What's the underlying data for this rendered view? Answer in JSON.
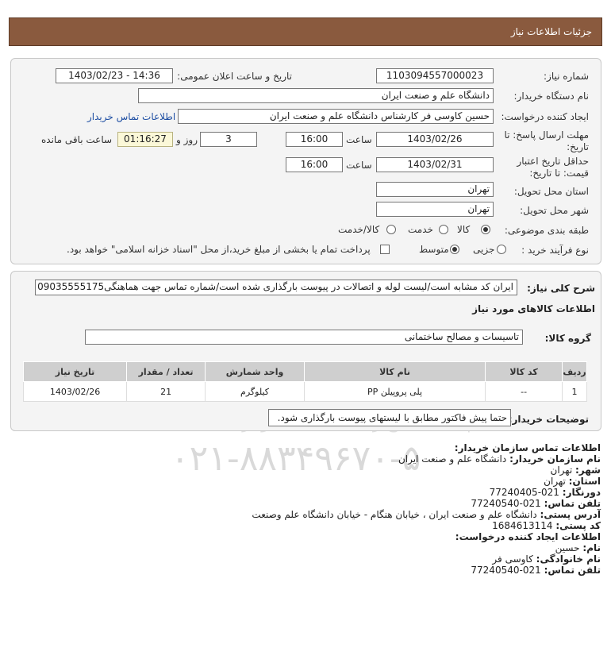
{
  "header": {
    "title": "جزئیات اطلاعات نیاز"
  },
  "form": {
    "need_number_label": "شماره نیاز:",
    "need_number": "1103094557000023",
    "announce_label": "تاریخ و ساعت اعلان عمومی:",
    "announce_value": "1403/02/23 - 14:36",
    "buyer_org_label": "نام دستگاه خریدار:",
    "buyer_org": "دانشگاه علم و صنعت ایران",
    "requester_label": "ایجاد کننده درخواست:",
    "requester": "حسین کاوسی فر کارشناس دانشگاه علم و صنعت ایران",
    "buyer_contact_link": "اطلاعات تماس خریدار",
    "deadline_label_1": "مهلت ارسال پاسخ: تا",
    "deadline_label_2": "تاریخ:",
    "deadline_date": "1403/02/26",
    "time_label": "ساعت",
    "deadline_time": "16:00",
    "days_value": "3",
    "days_label": "روز و",
    "remaining_value": "01:16:27",
    "remaining_label": "ساعت باقی مانده",
    "validity_label_1": "حداقل تاریخ اعتبار",
    "validity_label_2": "قیمت: تا تاریخ:",
    "validity_date": "1403/02/31",
    "validity_time": "16:00",
    "province_label": "استان محل تحویل:",
    "province": "تهران",
    "city_label": "شهر محل تحویل:",
    "city": "تهران",
    "category_label": "طبقه بندی موضوعی:",
    "category_options": [
      "کالا",
      "خدمت",
      "کالا/خدمت"
    ],
    "purchase_type_label": "نوع فرآیند خرید :",
    "purchase_options": [
      "جزیی",
      "متوسط"
    ],
    "payment_note": "پرداخت تمام یا بخشی از مبلغ خرید،از محل \"اسناد خزانه اسلامی\" خواهد بود."
  },
  "description": {
    "label": "شرح کلی نیاز:",
    "text": "ایران کد مشابه است/لیست لوله و اتصالات در پیوست بارگذاری شده است/شماره تماس جهت هماهنگی09035555175"
  },
  "goods": {
    "section_title": "اطلاعات کالاهای مورد نیاز",
    "group_label": "گروه کالا:",
    "group_value": "تاسیسات و مصالح ساختمانی",
    "columns": [
      "ردیف",
      "کد کالا",
      "نام کالا",
      "واحد شمارش",
      "تعداد / مقدار",
      "تاریخ نیاز"
    ],
    "rows": [
      [
        "1",
        "--",
        "پلی پروپیلن PP",
        "کیلوگرم",
        "21",
        "1403/02/26"
      ]
    ]
  },
  "buyer_notes": {
    "label": "توضیحات خریدار:",
    "text": "حتما پیش فاکتور مطابق با لیستهای پیوست بارگذاری شود."
  },
  "contact": {
    "title": "اطلاعات تماس سازمان خریدار:",
    "org_label": "نام سازمان خریدار:",
    "org": "دانشگاه علم و صنعت ایران",
    "city_label": "شهر:",
    "city": "تهران",
    "province_label": "استان:",
    "province": "تهران",
    "fax_label": "دورنگار:",
    "fax": "021-77240405",
    "phone_label": "تلفن تماس:",
    "phone": "021-77240540",
    "address_label": "آدرس پستی:",
    "address": "دانشگاه علم و صنعت ایران ، خیابان هنگام - خیابان دانشگاه علم وصنعت",
    "postal_label": "کد پستی:",
    "postal": "1684613114",
    "creator_title": "اطلاعات ایجاد کننده درخواست:",
    "first_name_label": "نام:",
    "first_name": "حسین",
    "last_name_label": "نام خانوادگی:",
    "last_name": "کاوسی فر",
    "creator_phone_label": "تلفن تماس:",
    "creator_phone": "021-77240540"
  },
  "watermark": {
    "brand": "ParsNamadData",
    "tagline": "مرکز فراهم آوری اطلاعات پارس نماد داده ها",
    "tagline2": "پایگاه اطلاع رسانی مناقصه ومزایده",
    "phone": "۰۲۱-۸۸۳۴۹۶۷۰-۵"
  }
}
